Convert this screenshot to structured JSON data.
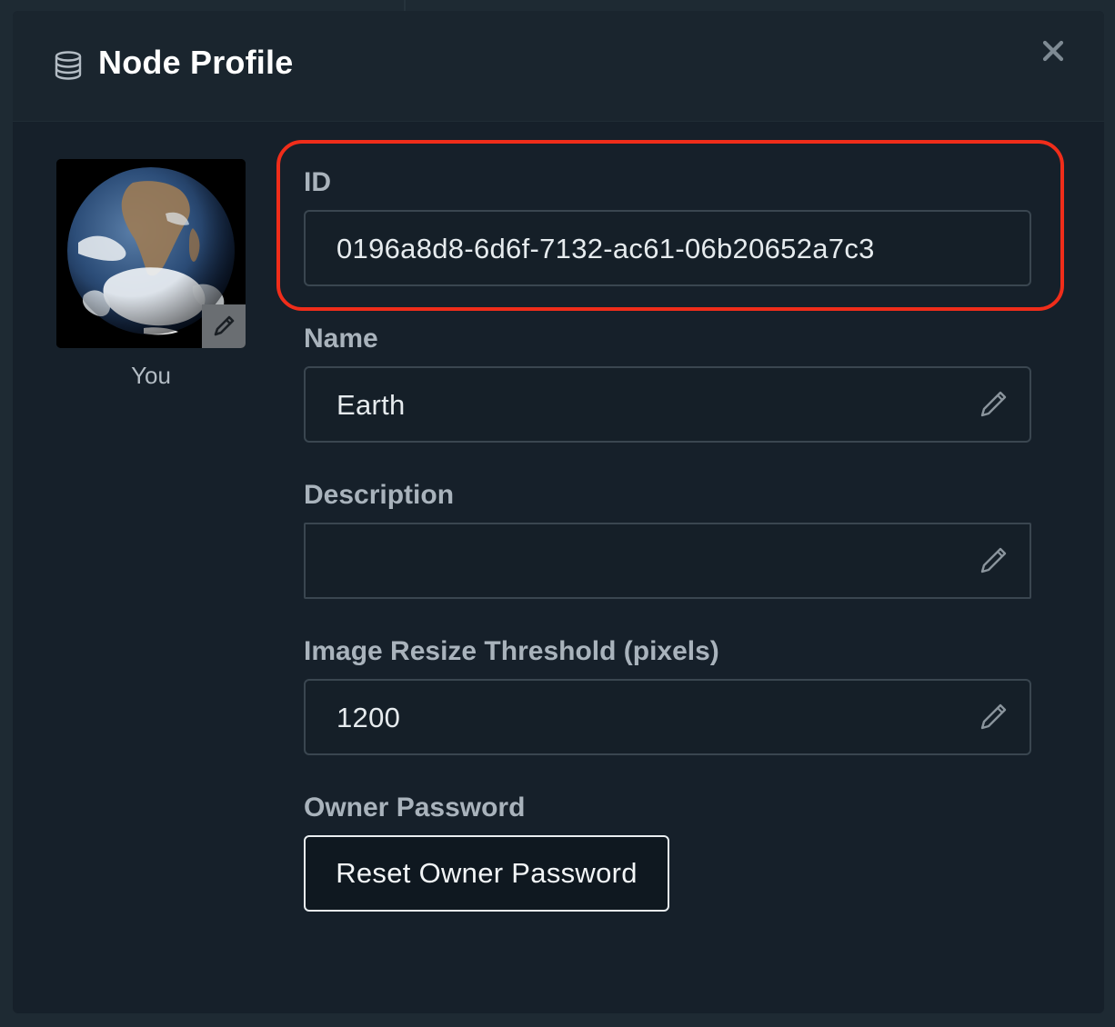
{
  "modal": {
    "title": "Node Profile",
    "header_icon": "database-icon",
    "close_icon": "close-icon"
  },
  "avatar": {
    "caption": "You",
    "image": "earth-globe",
    "edit_icon": "pencil-icon"
  },
  "fields": {
    "id": {
      "label": "ID",
      "value": "0196a8d8-6d6f-7132-ac61-06b20652a7c3"
    },
    "name": {
      "label": "Name",
      "value": "Earth",
      "edit_icon": "pencil-icon"
    },
    "description": {
      "label": "Description",
      "value": "",
      "edit_icon": "pencil-icon"
    },
    "image_resize_threshold": {
      "label": "Image Resize Threshold (pixels)",
      "value": "1200",
      "edit_icon": "pencil-icon"
    },
    "owner_password": {
      "label": "Owner Password",
      "button_label": "Reset Owner Password"
    }
  },
  "colors": {
    "background": "#16202a",
    "header": "#1a252e",
    "highlight": "#f02d1a",
    "label": "#a9b3bc",
    "text": "#e6ebee"
  }
}
